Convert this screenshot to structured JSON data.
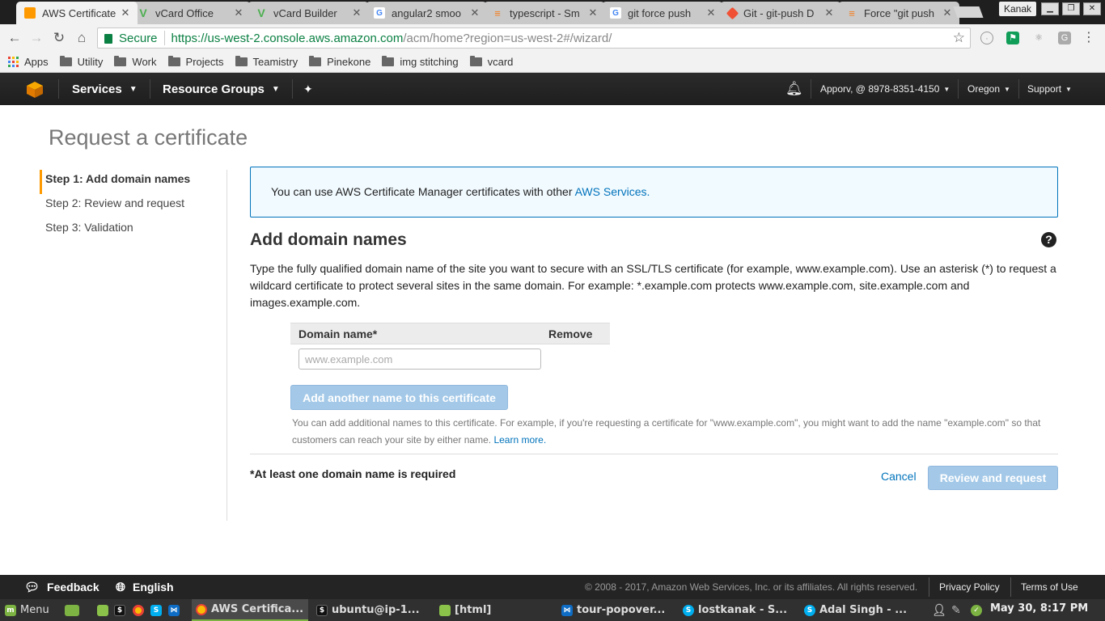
{
  "browser": {
    "tabs": [
      {
        "title": "AWS Certificate",
        "icon": "aws-box-icon",
        "color": "#f90"
      },
      {
        "title": "vCard Office",
        "icon": "vcard-icon",
        "color": "#4caf50"
      },
      {
        "title": "vCard Builder",
        "icon": "vcard-icon",
        "color": "#4caf50"
      },
      {
        "title": "angular2 smoo",
        "icon": "google-icon",
        "color": "#4285f4"
      },
      {
        "title": "typescript - Sm",
        "icon": "stackoverflow-icon",
        "color": "#f48024"
      },
      {
        "title": "git force push",
        "icon": "google-icon",
        "color": "#4285f4"
      },
      {
        "title": "Git - git-push D",
        "icon": "git-icon",
        "color": "#f05033"
      },
      {
        "title": "Force \"git push",
        "icon": "stackoverflow-icon",
        "color": "#f48024"
      }
    ],
    "profile": "Kanak",
    "secure_label": "Secure",
    "url_scheme_host": "https://us-west-2.console.aws.amazon.com",
    "url_path": "/acm/home?region=us-west-2#/wizard/",
    "bookmarks": [
      "Apps",
      "Utility",
      "Work",
      "Projects",
      "Teamistry",
      "Pinekone",
      "img stitching",
      "vcard"
    ]
  },
  "aws_nav": {
    "services": "Services",
    "resource_groups": "Resource Groups",
    "account": "Apporv, @ 8978-8351-4150",
    "region": "Oregon",
    "support": "Support"
  },
  "page": {
    "title": "Request a certificate",
    "steps": [
      "Step 1: Add domain names",
      "Step 2: Review and request",
      "Step 3: Validation"
    ],
    "info_text": "You can use AWS Certificate Manager certificates with other ",
    "info_link": "AWS Services.",
    "section_title": "Add domain names",
    "description": "Type the fully qualified domain name of the site you want to secure with an SSL/TLS certificate (for example, www.example.com). Use an asterisk (*) to request a wildcard certificate to protect several sites in the same domain. For example: *.example.com protects www.example.com, site.example.com and images.example.com.",
    "table_headers": [
      "Domain name*",
      "Remove"
    ],
    "domain_input": {
      "value": "",
      "placeholder": "www.example.com"
    },
    "add_button": "Add another name to this certificate",
    "hint_text": "You can add additional names to this certificate. For example, if you're requesting a certificate for \"www.example.com\", you might want to add the name \"example.com\" so that customers can reach your site by either name. ",
    "hint_link": "Learn more.",
    "required_note": "*At least one domain name is required",
    "cancel": "Cancel",
    "review_button": "Review and request"
  },
  "footer": {
    "feedback": "Feedback",
    "language": "English",
    "copyright": "© 2008 - 2017, Amazon Web Services, Inc. or its affiliates. All rights reserved.",
    "privacy": "Privacy Policy",
    "terms": "Terms of Use"
  },
  "taskbar": {
    "menu": "Menu",
    "windows": [
      "AWS Certifica...",
      "ubuntu@ip-1...",
      "[html]",
      "tour-popover...",
      "lostkanak - S...",
      "Adal Singh - ..."
    ],
    "clock": "May 30,  8:17 PM"
  }
}
